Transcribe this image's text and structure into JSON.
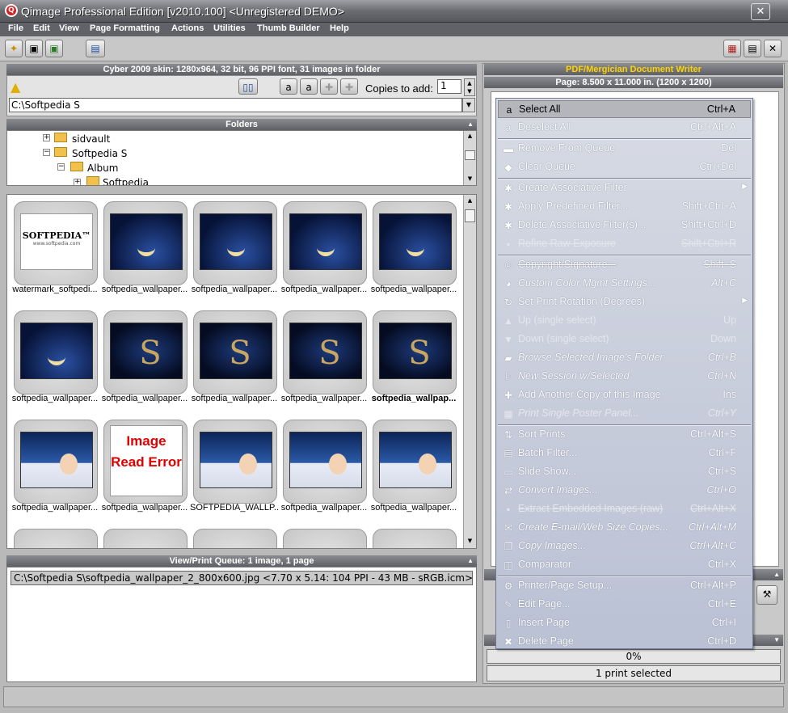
{
  "window": {
    "title": "Qimage Professional Edition [v2010.100] <Unregistered DEMO>",
    "close": "✕"
  },
  "menu": [
    "File",
    "Edit",
    "View",
    "Page Formatting",
    "Actions",
    "Utilities",
    "Thumb Builder",
    "Help"
  ],
  "left": {
    "info_header": "Cyber 2009 skin: 1280x964, 32 bit, 96 PPI font, 31 images in folder",
    "copies_label": "Copies to add:",
    "copies_value": "1",
    "path": "C:\\Softpedia S",
    "folders_header": "Folders",
    "tree": [
      "sidvault",
      "Softpedia S",
      "Album",
      "Softpedia"
    ]
  },
  "thumbnails": [
    {
      "caption": "watermark_softpedi...",
      "kind": "wm"
    },
    {
      "caption": "softpedia_wallpaper...",
      "kind": "night"
    },
    {
      "caption": "softpedia_wallpaper...",
      "kind": "night"
    },
    {
      "caption": "softpedia_wallpaper...",
      "kind": "night"
    },
    {
      "caption": "softpedia_wallpaper...",
      "kind": "night"
    },
    {
      "caption": "softpedia_wallpaper...",
      "kind": "night"
    },
    {
      "caption": "softpedia_wallpaper...",
      "kind": "ess"
    },
    {
      "caption": "softpedia_wallpaper...",
      "kind": "ess"
    },
    {
      "caption": "softpedia_wallpaper...",
      "kind": "ess"
    },
    {
      "caption": "softpedia_wallpap...",
      "kind": "ess",
      "bold": true
    },
    {
      "caption": "softpedia_wallpaper...",
      "kind": "girl"
    },
    {
      "caption": "softpedia_wallpaper...",
      "kind": "err"
    },
    {
      "caption": "SOFTPEDIA_WALLP...",
      "kind": "girl"
    },
    {
      "caption": "softpedia_wallpaper...",
      "kind": "girl"
    },
    {
      "caption": "softpedia_wallpaper...",
      "kind": "girl"
    }
  ],
  "thumb_texts": {
    "watermark": "SOFTPEDIA™",
    "watermark_sub": "www.softpedia.com",
    "error": "Image Read Error"
  },
  "queue": {
    "header": "View/Print Queue: 1 image, 1 page",
    "items": [
      "C:\\Softpedia S\\softpedia_wallpaper_2_800x600.jpg <7.70 x 5.14:  104 PPI -  43 MB - sRGB.icm>"
    ]
  },
  "right": {
    "writer": "PDF/Mergician Document Writer",
    "page": "Page: 8.500 x 11.000 in.  (1200 x 1200)",
    "progress_text": "0%",
    "progress": 0,
    "status": "1 print selected"
  },
  "context_menu": [
    {
      "label": "Select All",
      "shortcut": "Ctrl+A",
      "icon": "select-all-icon",
      "glyph": "a",
      "style": "hl"
    },
    {
      "label": "Deselect All",
      "shortcut": "Ctrl+Alt+A",
      "icon": "deselect-all-icon",
      "glyph": "a"
    },
    {
      "sep": true
    },
    {
      "label": "Remove From Queue",
      "shortcut": "Del",
      "icon": "remove-icon",
      "glyph": "▬"
    },
    {
      "label": "Clear Queue",
      "shortcut": "Ctrl+Del",
      "icon": "eraser-icon",
      "glyph": "◆"
    },
    {
      "sep": true
    },
    {
      "label": "Create Associative Filter",
      "shortcut": "",
      "icon": "filter-icon",
      "glyph": "✱",
      "sub": true
    },
    {
      "label": "Apply Predefined Filter...",
      "shortcut": "Shift+Ctrl+A",
      "icon": "filter-apply-icon",
      "glyph": "✱"
    },
    {
      "label": "Delete Associative Filter(s)...",
      "shortcut": "Shift+Ctrl+D",
      "icon": "filter-delete-icon",
      "glyph": "✱"
    },
    {
      "label": "Refine Raw Exposure",
      "shortcut": "Shift+Ctrl+R",
      "icon": "raw-icon",
      "glyph": "▪",
      "style": "dis st"
    },
    {
      "sep": true
    },
    {
      "label": "Copyright/Signature...",
      "shortcut": "Shift+S",
      "icon": "copyright-icon",
      "glyph": "©",
      "style": "st"
    },
    {
      "label": "Custom Color Mgmt Settings...",
      "shortcut": "Alt+C",
      "icon": "color-icon",
      "glyph": "◕",
      "style": "it"
    },
    {
      "label": "Set Print Rotation (Degrees)",
      "shortcut": "",
      "icon": "rotate-icon",
      "glyph": "↻",
      "sub": true
    },
    {
      "label": "Up (single select)",
      "shortcut": "Up",
      "icon": "up-icon",
      "glyph": "▲",
      "style": "dis"
    },
    {
      "label": "Down (single select)",
      "shortcut": "Down",
      "icon": "down-icon",
      "glyph": "▼",
      "style": "dis"
    },
    {
      "label": "Browse Selected Image's Folder",
      "shortcut": "Ctrl+B",
      "icon": "folder-icon",
      "glyph": "▰",
      "style": "it"
    },
    {
      "label": "New Session w/Selected",
      "shortcut": "Ctrl+N",
      "icon": "session-icon",
      "glyph": "⚐",
      "style": "it"
    },
    {
      "label": "Add Another Copy of this Image",
      "shortcut": "Ins",
      "icon": "add-copy-icon",
      "glyph": "✚"
    },
    {
      "label": "Print Single Poster Panel...",
      "shortcut": "Ctrl+Y",
      "icon": "poster-icon",
      "glyph": "▦",
      "style": "dis it"
    },
    {
      "sep": true
    },
    {
      "label": "Sort Prints",
      "shortcut": "Ctrl+Alt+S",
      "icon": "sort-icon",
      "glyph": "⇅"
    },
    {
      "label": "Batch Filter...",
      "shortcut": "Ctrl+F",
      "icon": "batch-icon",
      "glyph": "▤"
    },
    {
      "label": "Slide Show...",
      "shortcut": "Ctrl+S",
      "icon": "slideshow-icon",
      "glyph": "▭"
    },
    {
      "label": "Convert Images...",
      "shortcut": "Ctrl+O",
      "icon": "convert-icon",
      "glyph": "⇄",
      "style": "it"
    },
    {
      "label": "Extract Embedded Images (raw)",
      "shortcut": "Ctrl+Alt+X",
      "icon": "extract-icon",
      "glyph": "▪",
      "style": "dis st"
    },
    {
      "label": "Create E-mail/Web Size Copies...",
      "shortcut": "Ctrl+Alt+M",
      "icon": "email-icon",
      "glyph": "✉",
      "style": "it"
    },
    {
      "label": "Copy Images...",
      "shortcut": "Ctrl+Alt+C",
      "icon": "copy-icon",
      "glyph": "❐",
      "style": "it"
    },
    {
      "label": "Comparator",
      "shortcut": "Ctrl+X",
      "icon": "compare-icon",
      "glyph": "◫"
    },
    {
      "sep": true
    },
    {
      "label": "Printer/Page Setup...",
      "shortcut": "Ctrl+Alt+P",
      "icon": "printer-setup-icon",
      "glyph": "⚙"
    },
    {
      "label": "Edit Page...",
      "shortcut": "Ctrl+E",
      "icon": "edit-page-icon",
      "glyph": "✎"
    },
    {
      "label": "Insert Page",
      "shortcut": "Ctrl+I",
      "icon": "insert-page-icon",
      "glyph": "▯"
    },
    {
      "label": "Delete Page",
      "shortcut": "Ctrl+D",
      "icon": "delete-page-icon",
      "glyph": "✖"
    }
  ]
}
